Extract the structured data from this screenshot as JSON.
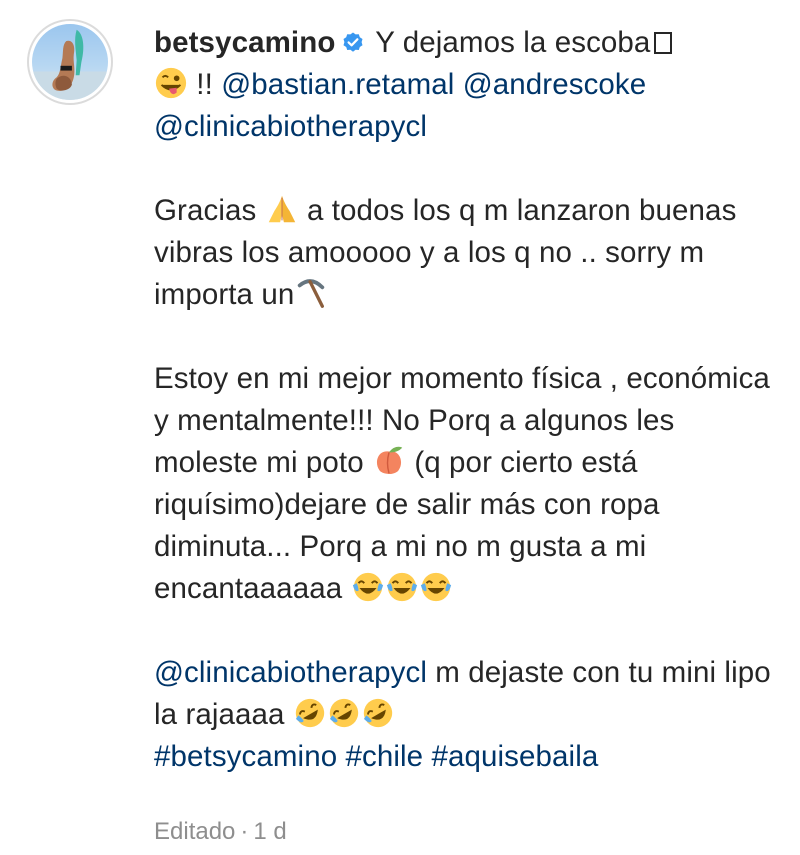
{
  "post": {
    "username": "betsycamino",
    "verified": true,
    "avatar_icon": "profile-photo",
    "line1_text": "Y dejamos la escoba",
    "line1b_text": "!!",
    "mention_1": "@bastian.retamal",
    "mention_2": "@andrescoke",
    "mention_3": "@clinicabiotherapycl",
    "para2_a": "Gracias",
    "para2_b": "a todos los q m lanzaron buenas vibras los amooooo y a los q no .. sorry m importa un",
    "para3_a": "Estoy en mi mejor momento física , económica y mentalmente!!! No Porq a algunos les moleste mi poto",
    "para3_b": "(q por cierto está riquísimo)dejare de salir más con ropa diminuta... Porq a mi no m gusta a mi encantaaaaaa",
    "para4_mention": "@clinicabiotherapycl",
    "para4_text": "m dejaste con tu mini lipo la rajaaaa",
    "hashtag_1": "#betsycamino",
    "hashtag_2": "#chile",
    "hashtag_3": "#aquisebaila"
  },
  "meta": {
    "edited_label": "Editado",
    "separator": "·",
    "time_ago": "1 d"
  },
  "colors": {
    "link": "#003569",
    "text": "#262626",
    "meta": "#8e8e8e",
    "verified": "#3897f0"
  },
  "icons": {
    "verified": "verified-badge-icon",
    "wink": "winking-tongue-emoji",
    "pray": "folded-hands-emoji",
    "pick": "pick-icon",
    "peach": "peach-emoji",
    "joy": "tears-of-joy-emoji",
    "rofl": "rolling-laughing-emoji"
  }
}
